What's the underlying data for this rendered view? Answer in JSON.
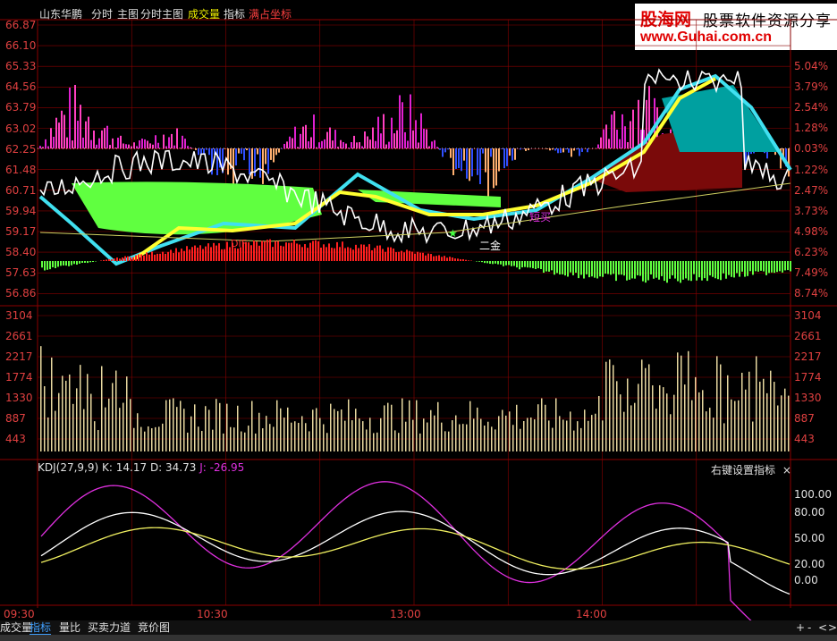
{
  "header": {
    "stock_name": "山东华鹏",
    "items": [
      "分时",
      "主图",
      "分时主图",
      "成交量",
      "指标"
    ],
    "highlight": "满占坐标"
  },
  "logo": {
    "line1": "股海网",
    "line1b": "股票软件资源分享",
    "line2": "www.Guhai.com.cn"
  },
  "price_axis": [
    "66.87",
    "66.10",
    "65.33",
    "64.56",
    "63.79",
    "63.02",
    "62.25",
    "61.48",
    "60.71",
    "59.94",
    "59.17",
    "58.40",
    "57.63",
    "56.86"
  ],
  "pct_axis": [
    "5.04%",
    "3.79%",
    "2.54%",
    "1.28%",
    "0.03%",
    "1.22%",
    "2.47%",
    "3.73%",
    "4.98%",
    "6.23%",
    "7.49%",
    "8.74%"
  ],
  "vol_axis": [
    "3104",
    "2661",
    "2217",
    "1774",
    "1330",
    "887",
    "443"
  ],
  "kdj": {
    "name": "KDJ(27,9,9)",
    "k": "K: 14.17",
    "d": "D: 34.73",
    "j": "J: -26.95",
    "axis": [
      "100.00",
      "80.00",
      "50.00",
      "20.00",
      "0.00"
    ],
    "settings": "右键设置指标",
    "close": "×"
  },
  "annotations": {
    "dif": "DIF",
    "short_buy": "短买",
    "gold": "二金",
    "star": "★"
  },
  "time_axis": [
    "09:30",
    "10:30",
    "13:00",
    "14:00"
  ],
  "tabs": [
    "成交量",
    "指标",
    "量比",
    "买卖力道",
    "竞价图"
  ],
  "tab_ctrl": [
    "+",
    "-",
    "<",
    ">"
  ],
  "colors": {
    "grid": "#8b0000",
    "white": "#ffffff",
    "yellow": "#ffff30",
    "cyan": "#40e0f0",
    "magenta": "#e020d0",
    "green": "#60ff40"
  }
}
